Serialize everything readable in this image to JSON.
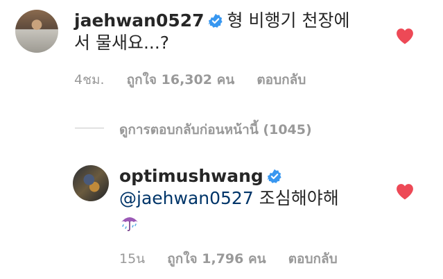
{
  "comments": [
    {
      "username": "jaehwan0527",
      "text_line1": "형 비행기 천장에",
      "text_line2": "서 물새요...?",
      "time": "4ชม.",
      "likes": "ถูกใจ 16,302 คน",
      "reply": "ตอบกลับ"
    },
    {
      "username": "optimushwang",
      "mention": "@jaehwan0527",
      "text": "조심해야해",
      "emoji": "☔",
      "time": "15น",
      "likes": "ถูกใจ 1,796 คน",
      "reply": "ตอบกลับ"
    }
  ],
  "view_previous": "ดูการตอบกลับก่อนหน้านี้ (1045)",
  "colors": {
    "heart": "#ed4956",
    "verified": "#3897f0",
    "muted": "#999999"
  }
}
